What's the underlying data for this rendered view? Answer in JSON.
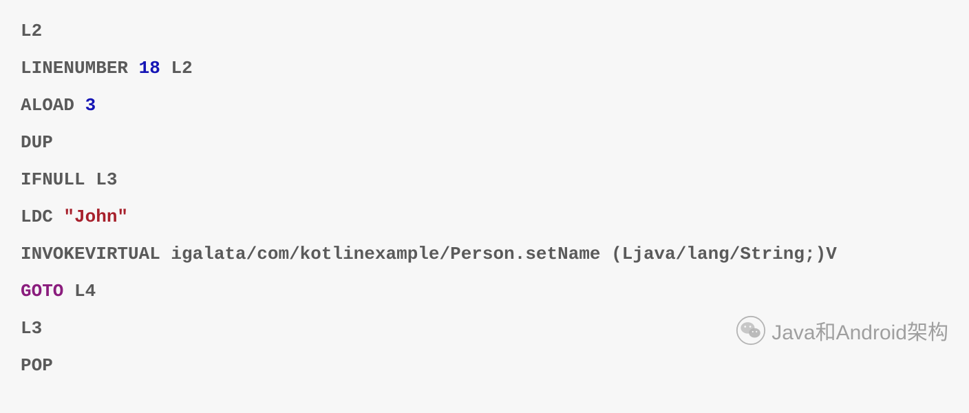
{
  "code": {
    "lines": [
      {
        "tokens": [
          {
            "type": "label",
            "text": "L2"
          }
        ]
      },
      {
        "tokens": [
          {
            "type": "instruction",
            "text": "LINENUMBER "
          },
          {
            "type": "number",
            "text": "18"
          },
          {
            "type": "instruction",
            "text": " L2"
          }
        ]
      },
      {
        "tokens": [
          {
            "type": "instruction",
            "text": "ALOAD "
          },
          {
            "type": "number",
            "text": "3"
          }
        ]
      },
      {
        "tokens": [
          {
            "type": "instruction",
            "text": "DUP"
          }
        ]
      },
      {
        "tokens": [
          {
            "type": "instruction",
            "text": "IFNULL L3"
          }
        ]
      },
      {
        "tokens": [
          {
            "type": "instruction",
            "text": "LDC "
          },
          {
            "type": "string",
            "text": "\"John\""
          }
        ]
      },
      {
        "tokens": [
          {
            "type": "instruction",
            "text": "INVOKEVIRTUAL igalata/com/kotlinexample/Person.setName (Ljava/lang/String;)V"
          }
        ]
      },
      {
        "tokens": [
          {
            "type": "goto",
            "text": "GOTO"
          },
          {
            "type": "instruction",
            "text": " L4"
          }
        ]
      },
      {
        "tokens": [
          {
            "type": "label",
            "text": "L3"
          }
        ]
      },
      {
        "tokens": [
          {
            "type": "instruction",
            "text": "POP"
          }
        ]
      }
    ]
  },
  "watermark": {
    "text": "Java和Android架构"
  }
}
